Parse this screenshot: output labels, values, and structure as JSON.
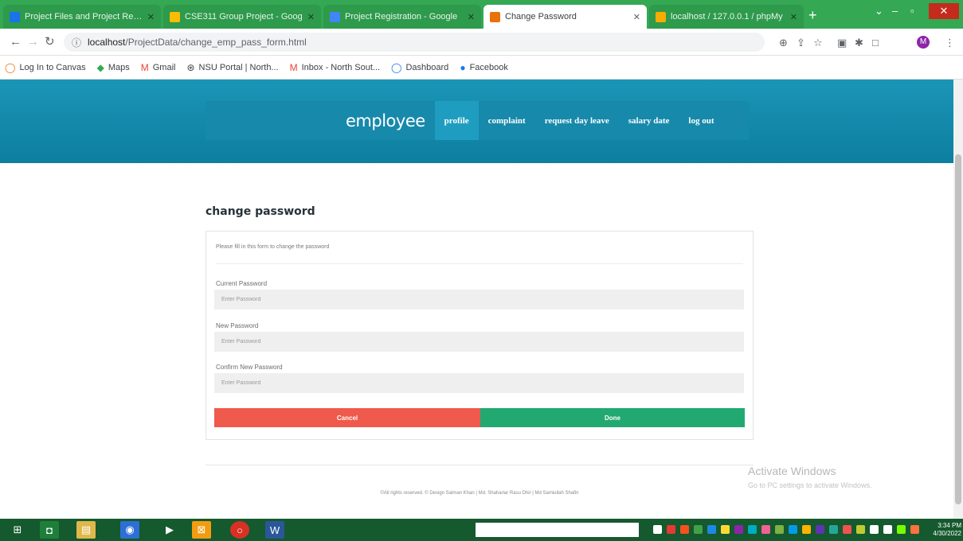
{
  "browser": {
    "tabs": [
      {
        "title": "Project Files and Project Repo",
        "favicon_color": "#1a73e8"
      },
      {
        "title": "CSE311 Group Project - Goog",
        "favicon_color": "#fbbc04"
      },
      {
        "title": "Project Registration - Google",
        "favicon_color": "#4285f4"
      },
      {
        "title": "Change Password",
        "favicon_color": "#e8710a",
        "active": true
      },
      {
        "title": "localhost / 127.0.0.1 / phpMy",
        "favicon_color": "#f9ab00"
      }
    ],
    "new_tab_label": "+",
    "close_glyph": "✕",
    "url_host": "localhost",
    "url_path": "/ProjectData/change_emp_pass_form.html",
    "profile_initial": "M"
  },
  "bookmarks": [
    {
      "label": "Log In to Canvas",
      "icon": "circle-icon",
      "color": "#e8710a"
    },
    {
      "label": "Maps",
      "icon": "maps-icon",
      "color": "#34a853"
    },
    {
      "label": "Gmail",
      "icon": "gmail-icon",
      "color": "#ea4335"
    },
    {
      "label": "NSU Portal | North...",
      "icon": "globe-icon",
      "color": "#3c4043"
    },
    {
      "label": "Inbox - North Sout...",
      "icon": "gmail-icon",
      "color": "#ea4335"
    },
    {
      "label": "Dashboard",
      "icon": "circle-icon",
      "color": "#1a73e8"
    },
    {
      "label": "Facebook",
      "icon": "facebook-icon",
      "color": "#1877f2"
    }
  ],
  "site": {
    "brand": "employee",
    "nav": [
      {
        "label": "profile",
        "active": true
      },
      {
        "label": "complaint"
      },
      {
        "label": "request day leave"
      },
      {
        "label": "salary date"
      },
      {
        "label": "log out"
      }
    ]
  },
  "form": {
    "page_title": "change password",
    "intro": "Please fill in this form to change the password",
    "fields": [
      {
        "label": "Current Password",
        "placeholder": "Enter Password"
      },
      {
        "label": "New Password",
        "placeholder": "Enter Password"
      },
      {
        "label": "Confirm New Password",
        "placeholder": "Enter Password"
      }
    ],
    "cancel_label": "Cancel",
    "done_label": "Done"
  },
  "footer": {
    "text": "©All rights reserved. © Design Salman Khan | Md. Shahariar Rasu Dhir | Md Samiullah Shafin"
  },
  "watermark": {
    "title": "Activate Windows",
    "subtitle": "Go to PC settings to activate Windows."
  },
  "taskbar": {
    "time": "3:34 PM",
    "date": "4/30/2022"
  },
  "colors": {
    "hero": "#1789ab",
    "cancel": "#ef5a4c",
    "done": "#21a971",
    "chrome_frame": "#34a853"
  }
}
